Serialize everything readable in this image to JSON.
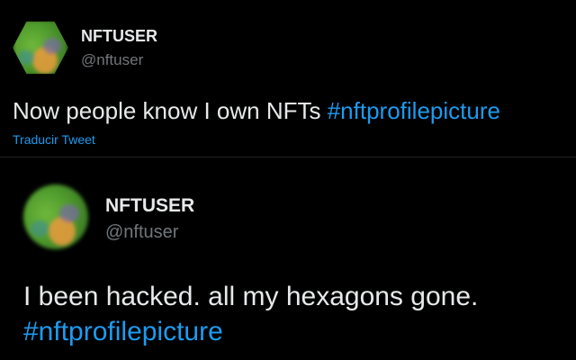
{
  "tweets": [
    {
      "display_name": "NFTUSER",
      "handle": "@nftuser",
      "text": "Now people know I own NFTs ",
      "hashtag": "#nftprofilepicture",
      "translate_label": "Traducir Tweet"
    },
    {
      "display_name": "NFTUSER",
      "handle": "@nftuser",
      "text": "I been hacked. all my hexagons gone.",
      "hashtag": "#nftprofilepicture"
    }
  ],
  "colors": {
    "background": "#000000",
    "text_primary": "#e7e9ea",
    "text_secondary": "#71767b",
    "accent": "#1d9bf0"
  },
  "icons": {
    "tweet1_avatar": "hexagon-nft-avatar-icon",
    "tweet2_avatar": "circle-avatar-icon"
  }
}
